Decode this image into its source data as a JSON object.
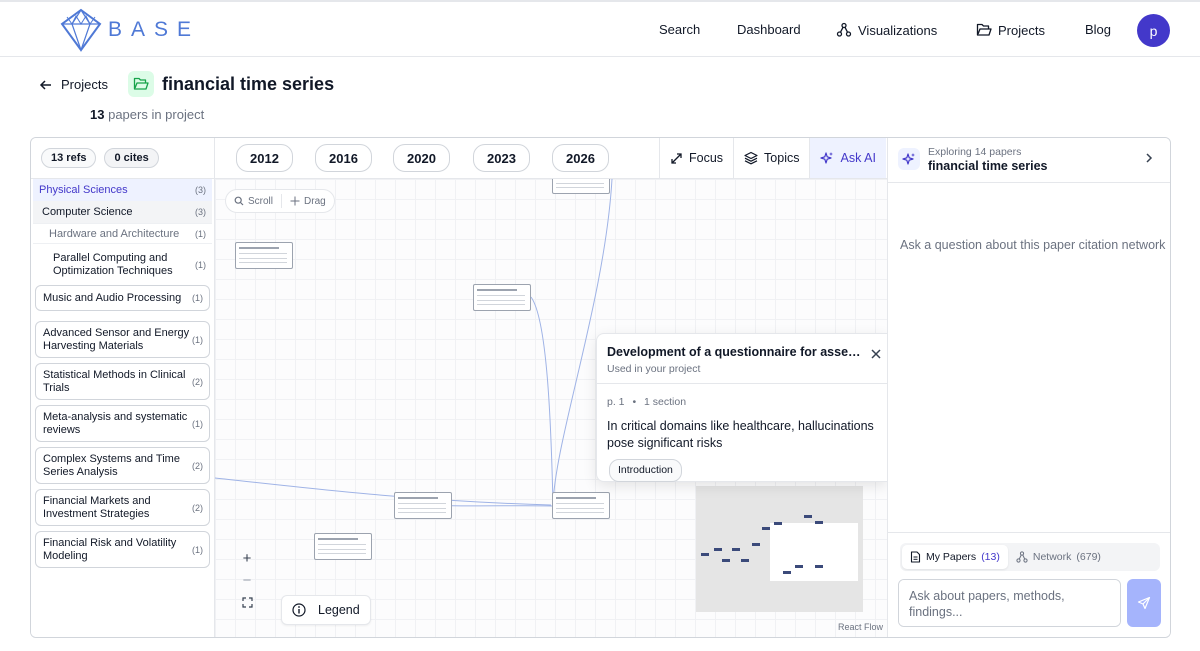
{
  "nav": {
    "brand": "BASE",
    "search": "Search",
    "dashboard": "Dashboard",
    "visualizations": "Visualizations",
    "projects": "Projects",
    "blog": "Blog",
    "avatar_initial": "p"
  },
  "header": {
    "back_label": "Projects",
    "project_title": "financial time series",
    "paper_count": "13",
    "paper_count_suffix": "papers in project"
  },
  "sidebar": {
    "refs": "13 refs",
    "cites": "0 cites",
    "root": {
      "label": "Physical Sciences",
      "count": "(3)"
    },
    "sub": {
      "label": "Computer Science",
      "count": "(3)"
    },
    "sub2": {
      "label": "Hardware and Architecture",
      "count": "(1)"
    },
    "sub3": {
      "label": "Parallel Computing and Optimization Techniques",
      "count": "(1)"
    },
    "categories": [
      {
        "label": "Music and Audio Processing",
        "count": "(1)"
      },
      {
        "label": "Advanced Sensor and Energy Harvesting Materials",
        "count": "(1)"
      },
      {
        "label": "Statistical Methods in Clinical Trials",
        "count": "(2)"
      },
      {
        "label": "Meta-analysis and systematic reviews",
        "count": "(1)"
      },
      {
        "label": "Complex Systems and Time Series Analysis",
        "count": "(2)"
      },
      {
        "label": "Financial Markets and Investment Strategies",
        "count": "(2)"
      },
      {
        "label": "Financial Risk and Volatility Modeling",
        "count": "(1)"
      }
    ]
  },
  "timeline": {
    "years": [
      "2012",
      "2016",
      "2020",
      "2023",
      "2026"
    ]
  },
  "tools": {
    "focus": "Focus",
    "topics": "Topics",
    "ask_ai": "Ask AI"
  },
  "canvas": {
    "scroll": "Scroll",
    "drag": "Drag",
    "legend": "Legend",
    "react_flow": "React Flow"
  },
  "popover": {
    "title": "Development of a questionnaire for assessi...",
    "subtitle": "Used in your project",
    "page": "p. 1",
    "sections": "1 section",
    "quote": "In critical domains like healthcare, hallucinations pose significant risks",
    "tag": "Introduction"
  },
  "ai_panel": {
    "subtitle": "Exploring 14 papers",
    "title": "financial time series",
    "empty_prompt": "Ask a question about this paper citation network",
    "my_papers": "My Papers",
    "my_papers_count": "(13)",
    "network": "Network",
    "network_count": "(679)",
    "input_placeholder": "Ask about papers, methods, findings..."
  },
  "colors": {
    "accent": "#4338ca",
    "brand": "#4f79d6",
    "send": "#a5b4fc"
  }
}
